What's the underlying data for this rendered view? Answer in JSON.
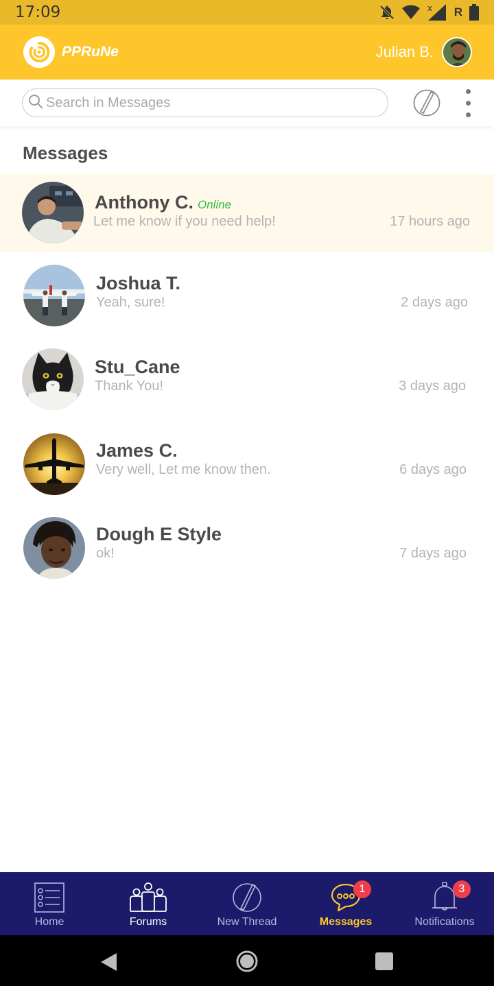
{
  "status_bar": {
    "time": "17:09",
    "roaming_indicator": "R",
    "icons": [
      "notifications-off-icon",
      "wifi-icon",
      "signal-icon",
      "battery-icon"
    ]
  },
  "header": {
    "app_name": "PPRuNe",
    "user_name": "Julian B.",
    "brand_color": "#fec62b",
    "logo_icon": "pprune-logo-icon"
  },
  "search": {
    "placeholder": "Search in Messages",
    "value": ""
  },
  "section": {
    "title": "Messages"
  },
  "messages": [
    {
      "name": "Anthony C.",
      "status": "Online",
      "preview": "Let me know if you need help!",
      "time": "17 hours ago",
      "highlighted": true
    },
    {
      "name": "Joshua T.",
      "status": "",
      "preview": "Yeah, sure!",
      "time": "2 days ago",
      "highlighted": false
    },
    {
      "name": "Stu_Cane",
      "status": "",
      "preview": "Thank You!",
      "time": "3 days ago",
      "highlighted": false
    },
    {
      "name": "James C.",
      "status": "",
      "preview": "Very well, Let me know then.",
      "time": "6 days ago",
      "highlighted": false
    },
    {
      "name": "Dough E Style",
      "status": "",
      "preview": "ok!",
      "time": "7 days ago",
      "highlighted": false
    }
  ],
  "bottom_nav": {
    "items": [
      {
        "label": "Home",
        "icon": "home-list-icon"
      },
      {
        "label": "Forums",
        "icon": "forums-people-icon"
      },
      {
        "label": "New Thread",
        "icon": "pen-icon"
      },
      {
        "label": "Messages",
        "icon": "chat-bubble-icon",
        "badge": "1",
        "active": true
      },
      {
        "label": "Notifications",
        "icon": "bell-icon",
        "badge": "3"
      }
    ],
    "background": "#1c1a6b",
    "active_color": "#fec62b"
  }
}
